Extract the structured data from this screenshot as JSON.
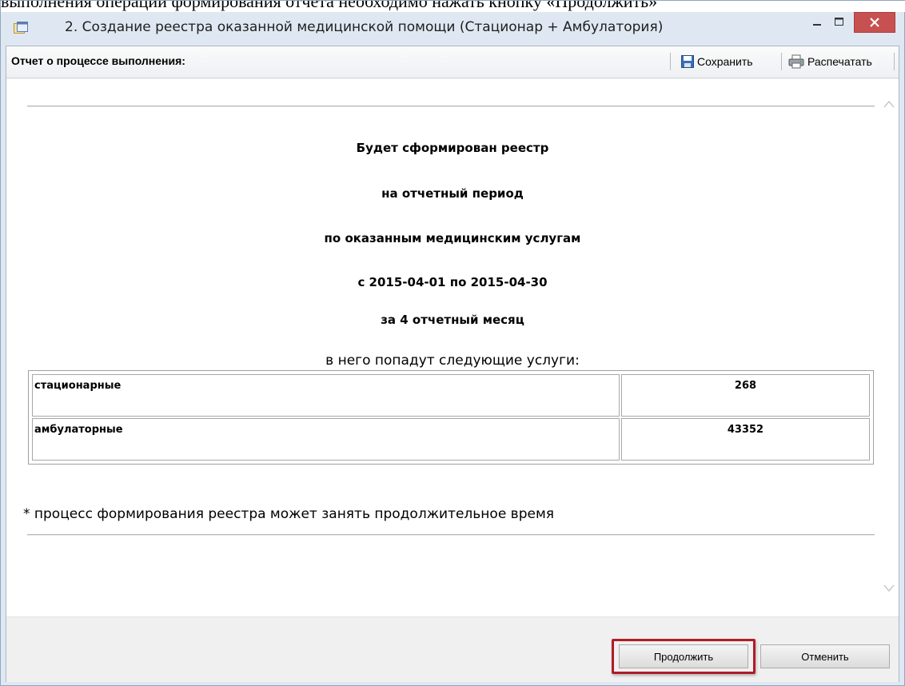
{
  "background_text": "выполнения операции формирования отчета необходимо нажать кнопку «Продолжить»",
  "window": {
    "title": "2. Создание реестра оказанной медицинской помощи (Стационар + Амбулатория)",
    "icon": "app-window-icon",
    "controls": {
      "minimize": "minimize-icon",
      "maximize": "maximize-icon",
      "close": "close-icon"
    }
  },
  "toolbar": {
    "label": "Отчет о процессе выполнения:",
    "save_label": "Сохранить",
    "save_icon": "floppy-disk-icon",
    "print_label": "Распечатать",
    "print_icon": "printer-icon"
  },
  "report": {
    "lines": [
      "Будет сформирован реестр",
      "на отчетный период",
      "по оказанным медицинским услугам",
      "с 2015-04-01 по 2015-04-30",
      "за 4 отчетный месяц"
    ],
    "services_intro": "в него попадут следующие услуги:",
    "services": [
      {
        "name": "стационарные",
        "count": "268"
      },
      {
        "name": "амбулаторные",
        "count": "43352"
      }
    ],
    "note": "* процесс формирования реестра может занять продолжительное время"
  },
  "buttons": {
    "continue_label": "Продолжить",
    "cancel_label": "Отменить",
    "highlight_color": "#b01c28"
  },
  "colors": {
    "close_button": "#c75050",
    "frame": "#dfe8f2"
  }
}
